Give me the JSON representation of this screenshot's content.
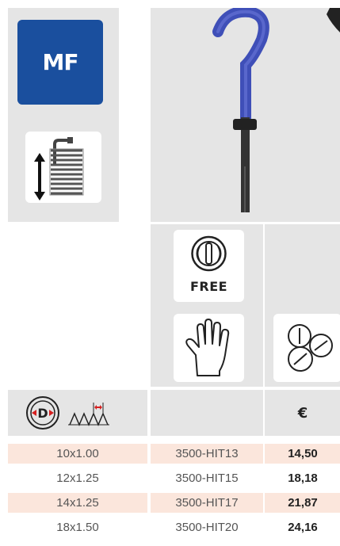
{
  "badge": {
    "label": "MF"
  },
  "icons": {
    "free_label": "FREE"
  },
  "table": {
    "currency_header": "€",
    "rows": [
      {
        "size": "10x1.00",
        "code": "3500-HIT13",
        "price": "14,50"
      },
      {
        "size": "12x1.25",
        "code": "3500-HIT15",
        "price": "18,18"
      },
      {
        "size": "14x1.25",
        "code": "3500-HIT17",
        "price": "21,87"
      },
      {
        "size": "18x1.50",
        "code": "3500-HIT20",
        "price": "24,16"
      }
    ]
  },
  "colors": {
    "badge_blue": "#1a4f9e",
    "panel_grey": "#e5e5e5",
    "row_highlight": "#fbe6dc",
    "accent_red": "#d62020",
    "tool_blue": "#3f4fb8"
  }
}
